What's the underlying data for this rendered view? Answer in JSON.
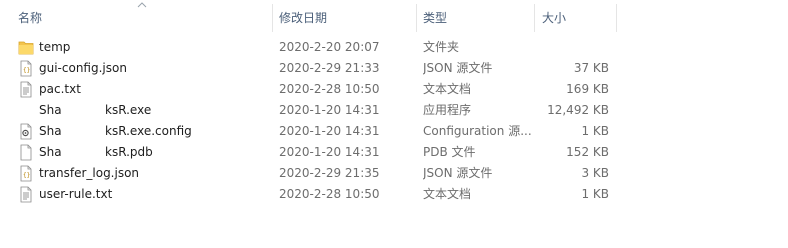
{
  "columns": {
    "name": "名称",
    "date": "修改日期",
    "type": "类型",
    "size": "大小"
  },
  "files": [
    {
      "name": "temp",
      "date": "2020-2-20 20:07",
      "type": "文件夹",
      "size": "",
      "icon": "folder-icon"
    },
    {
      "name": "gui-config.json",
      "date": "2020-2-29 21:33",
      "type": "JSON 源文件",
      "size": "37 KB",
      "icon": "json-file-icon"
    },
    {
      "name": "pac.txt",
      "date": "2020-2-28 10:50",
      "type": "文本文档",
      "size": "169 KB",
      "icon": "text-file-icon"
    },
    {
      "name_prefix": "Sha",
      "name_suffix": "ksR.exe",
      "date": "2020-1-20 14:31",
      "type": "应用程序",
      "size": "12,492 KB",
      "icon": "app-icon"
    },
    {
      "name_prefix": "Sha",
      "name_suffix": "ksR.exe.config",
      "date": "2020-1-20 14:31",
      "type": "Configuration 源...",
      "size": "1 KB",
      "icon": "config-file-icon"
    },
    {
      "name_prefix": "Sha",
      "name_suffix": "ksR.pdb",
      "date": "2020-1-20 14:31",
      "type": "PDB 文件",
      "size": "152 KB",
      "icon": "file-icon"
    },
    {
      "name": "transfer_log.json",
      "date": "2020-2-29 21:35",
      "type": "JSON 源文件",
      "size": "3 KB",
      "icon": "json-file-icon"
    },
    {
      "name": "user-rule.txt",
      "date": "2020-2-28 10:50",
      "type": "文本文档",
      "size": "1 KB",
      "icon": "text-file-icon"
    }
  ]
}
